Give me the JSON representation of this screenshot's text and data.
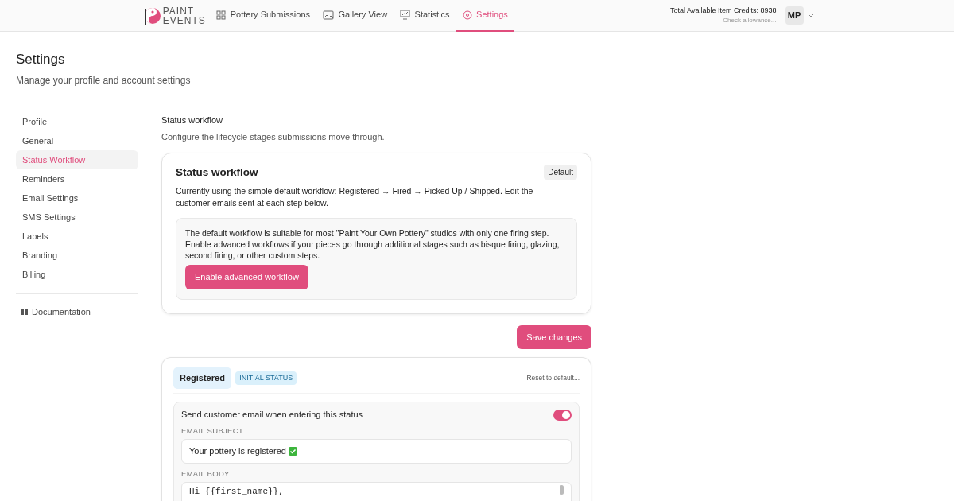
{
  "brand": {
    "line_1": "PAINT",
    "line_2": "EVENTS"
  },
  "nav": [
    {
      "label": "Pottery Submissions",
      "selected": false
    },
    {
      "label": "Gallery View",
      "selected": false
    },
    {
      "label": "Statistics",
      "selected": false
    },
    {
      "label": "Settings",
      "selected": true
    }
  ],
  "credits": {
    "text": "Total Available Item Credits: 8938",
    "link": "Check allowance..."
  },
  "avatar": "MP",
  "page": {
    "title": "Settings",
    "subtitle": "Manage your profile and account settings"
  },
  "sidebar": {
    "items": [
      {
        "label": "Profile",
        "selected": false
      },
      {
        "label": "General",
        "selected": false
      },
      {
        "label": "Status Workflow",
        "selected": true
      },
      {
        "label": "Reminders",
        "selected": false
      },
      {
        "label": "Email Settings",
        "selected": false
      },
      {
        "label": "SMS Settings",
        "selected": false
      },
      {
        "label": "Labels",
        "selected": false
      },
      {
        "label": "Branding",
        "selected": false
      },
      {
        "label": "Billing",
        "selected": false
      }
    ],
    "footer_link": "Documentation"
  },
  "section": {
    "title": "Status workflow",
    "description": "Configure the lifecycle stages submissions move through."
  },
  "workflow_card": {
    "title": "Status workflow",
    "badge": "Default",
    "text": "Currently using the simple default workflow: Registered → Fired → Picked Up / Shipped. Edit the customer emails sent at each step below.",
    "note": "The default workflow is suitable for most \"Paint Your Own Pottery\" studios with only one firing step. Enable advanced workflows if your pieces go through additional stages such as bisque firing, glazing, second firing, or other custom steps.",
    "button": "Enable advanced workflow"
  },
  "save_button": "Save changes",
  "status_card": {
    "name": "Registered",
    "tag": "INITIAL STATUS",
    "reset": "Reset to default...",
    "toggle_label": "Send customer email when entering this status",
    "toggle_on": true,
    "subject_label": "EMAIL SUBJECT",
    "subject": "Your pottery is registered",
    "body_label": "EMAIL BODY",
    "body": "Hi {{first_name}},"
  }
}
